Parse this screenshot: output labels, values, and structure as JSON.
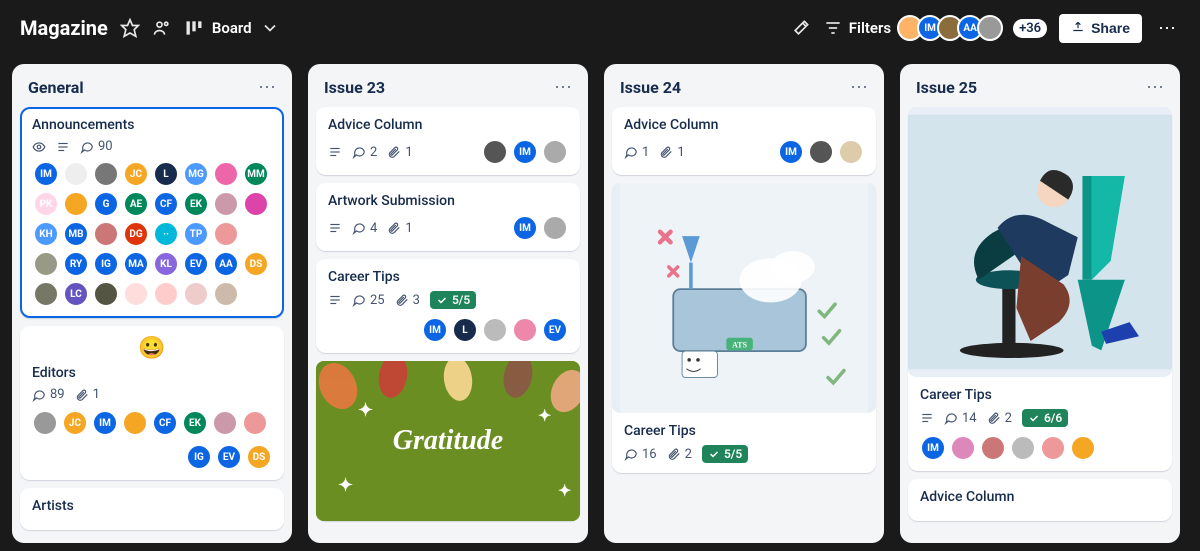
{
  "header": {
    "title": "Magazine",
    "view_label": "Board",
    "filters_label": "Filters",
    "overflow": "+36",
    "share_label": "Share",
    "header_avatars": [
      {
        "bg": "#ffb366",
        "txt": ""
      },
      {
        "bg": "#0c66e4",
        "txt": "IM"
      },
      {
        "bg": "#8a6d3b",
        "txt": ""
      },
      {
        "bg": "#0c66e4",
        "txt": "AA"
      },
      {
        "bg": "#999",
        "txt": ""
      }
    ]
  },
  "lists": [
    {
      "title": "General",
      "cards": [
        {
          "title": "Announcements",
          "selected": true,
          "badges": [
            {
              "t": "watch"
            },
            {
              "t": "desc"
            },
            {
              "t": "comment",
              "v": "90"
            }
          ],
          "member_grid": [
            {
              "bg": "#0c66e4",
              "txt": "IM"
            },
            {
              "bg": "#eee",
              "txt": ""
            },
            {
              "bg": "#777",
              "txt": ""
            },
            {
              "bg": "#f5a623",
              "txt": "JC"
            },
            {
              "bg": "#172b4d",
              "txt": "L"
            },
            {
              "bg": "#4c9aff",
              "txt": "MG"
            },
            {
              "bg": "#e6a",
              "txt": ""
            },
            {
              "bg": "#00875a",
              "txt": "MM"
            },
            {
              "bg": "#ffd6e7",
              "txt": "PK"
            },
            {
              "bg": "#f5a623",
              "txt": ""
            },
            {
              "bg": "#0c66e4",
              "txt": "G"
            },
            {
              "bg": "#00875a",
              "txt": "AE"
            },
            {
              "bg": "#0c66e4",
              "txt": "CF"
            },
            {
              "bg": "#00875a",
              "txt": "EK"
            },
            {
              "bg": "#c9a",
              "txt": ""
            },
            {
              "bg": "#d4a",
              "txt": ""
            },
            {
              "bg": "#4c9aff",
              "txt": "KH"
            },
            {
              "bg": "#0c66e4",
              "txt": "MB"
            },
            {
              "bg": "#c77",
              "txt": ""
            },
            {
              "bg": "#de350b",
              "txt": "DG"
            },
            {
              "bg": "#00b8d9",
              "txt": "··"
            },
            {
              "bg": "#4c9aff",
              "txt": "TP"
            },
            {
              "bg": "#e99",
              "txt": ""
            },
            {
              "bg": "#fff",
              "txt": ""
            },
            {
              "bg": "#998",
              "txt": ""
            },
            {
              "bg": "#0c66e4",
              "txt": "RY"
            },
            {
              "bg": "#0c66e4",
              "txt": "IG"
            },
            {
              "bg": "#0c66e4",
              "txt": "MA"
            },
            {
              "bg": "#86d",
              "txt": "KL"
            },
            {
              "bg": "#0c66e4",
              "txt": "EV"
            },
            {
              "bg": "#0c66e4",
              "txt": "AA"
            },
            {
              "bg": "#f5a623",
              "txt": "DS"
            },
            {
              "bg": "#776",
              "txt": ""
            },
            {
              "bg": "#6554c0",
              "txt": "LC"
            },
            {
              "bg": "#554",
              "txt": ""
            },
            {
              "bg": "#fdd",
              "txt": ""
            },
            {
              "bg": "#fcc",
              "txt": ""
            },
            {
              "bg": "#ecc",
              "txt": ""
            },
            {
              "bg": "#cba",
              "txt": ""
            }
          ]
        },
        {
          "title": "Editors",
          "emoji": "😀",
          "badges": [
            {
              "t": "comment",
              "v": "89"
            },
            {
              "t": "attach",
              "v": "1"
            }
          ],
          "member_rowA": [
            {
              "bg": "#999",
              "txt": ""
            },
            {
              "bg": "#f5a623",
              "txt": "JC"
            },
            {
              "bg": "#0c66e4",
              "txt": "IM"
            },
            {
              "bg": "#f5a623",
              "txt": ""
            },
            {
              "bg": "#0c66e4",
              "txt": "CF"
            },
            {
              "bg": "#00875a",
              "txt": "EK"
            },
            {
              "bg": "#c9a",
              "txt": ""
            },
            {
              "bg": "#e99",
              "txt": ""
            }
          ],
          "member_rowB": [
            {
              "bg": "#0c66e4",
              "txt": "IG"
            },
            {
              "bg": "#0c66e4",
              "txt": "EV"
            },
            {
              "bg": "#f5a623",
              "txt": "DS"
            }
          ]
        },
        {
          "title": "Artists"
        }
      ]
    },
    {
      "title": "Issue 23",
      "cards": [
        {
          "title": "Advice Column",
          "badges": [
            {
              "t": "desc"
            },
            {
              "t": "comment",
              "v": "2"
            },
            {
              "t": "attach",
              "v": "1"
            }
          ],
          "members_right": [
            {
              "bg": "#555",
              "txt": ""
            },
            {
              "bg": "#0c66e4",
              "txt": "IM"
            },
            {
              "bg": "#aaa",
              "txt": ""
            }
          ]
        },
        {
          "title": "Artwork Submission",
          "badges": [
            {
              "t": "desc"
            },
            {
              "t": "comment",
              "v": "4"
            },
            {
              "t": "attach",
              "v": "1"
            }
          ],
          "members_right": [
            {
              "bg": "#0c66e4",
              "txt": "IM"
            },
            {
              "bg": "#aaa",
              "txt": ""
            }
          ]
        },
        {
          "title": "Career Tips",
          "badges": [
            {
              "t": "desc"
            },
            {
              "t": "comment",
              "v": "25"
            },
            {
              "t": "attach",
              "v": "3"
            },
            {
              "t": "check",
              "v": "5/5"
            }
          ],
          "members_right_row2": [
            {
              "bg": "#0c66e4",
              "txt": "IM"
            },
            {
              "bg": "#172b4d",
              "txt": "L"
            },
            {
              "bg": "#bbb",
              "txt": ""
            },
            {
              "bg": "#e8a",
              "txt": ""
            },
            {
              "bg": "#0c66e4",
              "txt": "EV"
            }
          ]
        },
        {
          "cover": "gratitude",
          "cover_text": "Gratitude"
        }
      ]
    },
    {
      "title": "Issue 24",
      "cards": [
        {
          "title": "Advice Column",
          "badges": [
            {
              "t": "comment",
              "v": "1"
            },
            {
              "t": "attach",
              "v": "1"
            }
          ],
          "members_right": [
            {
              "bg": "#0c66e4",
              "txt": "IM"
            },
            {
              "bg": "#555",
              "txt": ""
            },
            {
              "bg": "#dca",
              "txt": ""
            }
          ]
        },
        {
          "cover": "machine",
          "title_below": "Career Tips",
          "badges_below": [
            {
              "t": "comment",
              "v": "16"
            },
            {
              "t": "attach",
              "v": "2"
            },
            {
              "t": "check",
              "v": "5/5"
            }
          ]
        }
      ]
    },
    {
      "title": "Issue 25",
      "cards": [
        {
          "cover": "desk",
          "title_below": "Career Tips",
          "badges_below": [
            {
              "t": "desc"
            },
            {
              "t": "comment",
              "v": "14"
            },
            {
              "t": "attach",
              "v": "2"
            },
            {
              "t": "check",
              "v": "6/6"
            }
          ],
          "members_below": [
            {
              "bg": "#0c66e4",
              "txt": "IM"
            },
            {
              "bg": "#d8b",
              "txt": ""
            },
            {
              "bg": "#c77",
              "txt": ""
            },
            {
              "bg": "#bbb",
              "txt": ""
            },
            {
              "bg": "#e99",
              "txt": ""
            },
            {
              "bg": "#f5a623",
              "txt": ""
            }
          ]
        },
        {
          "title": "Advice Column"
        }
      ]
    }
  ]
}
